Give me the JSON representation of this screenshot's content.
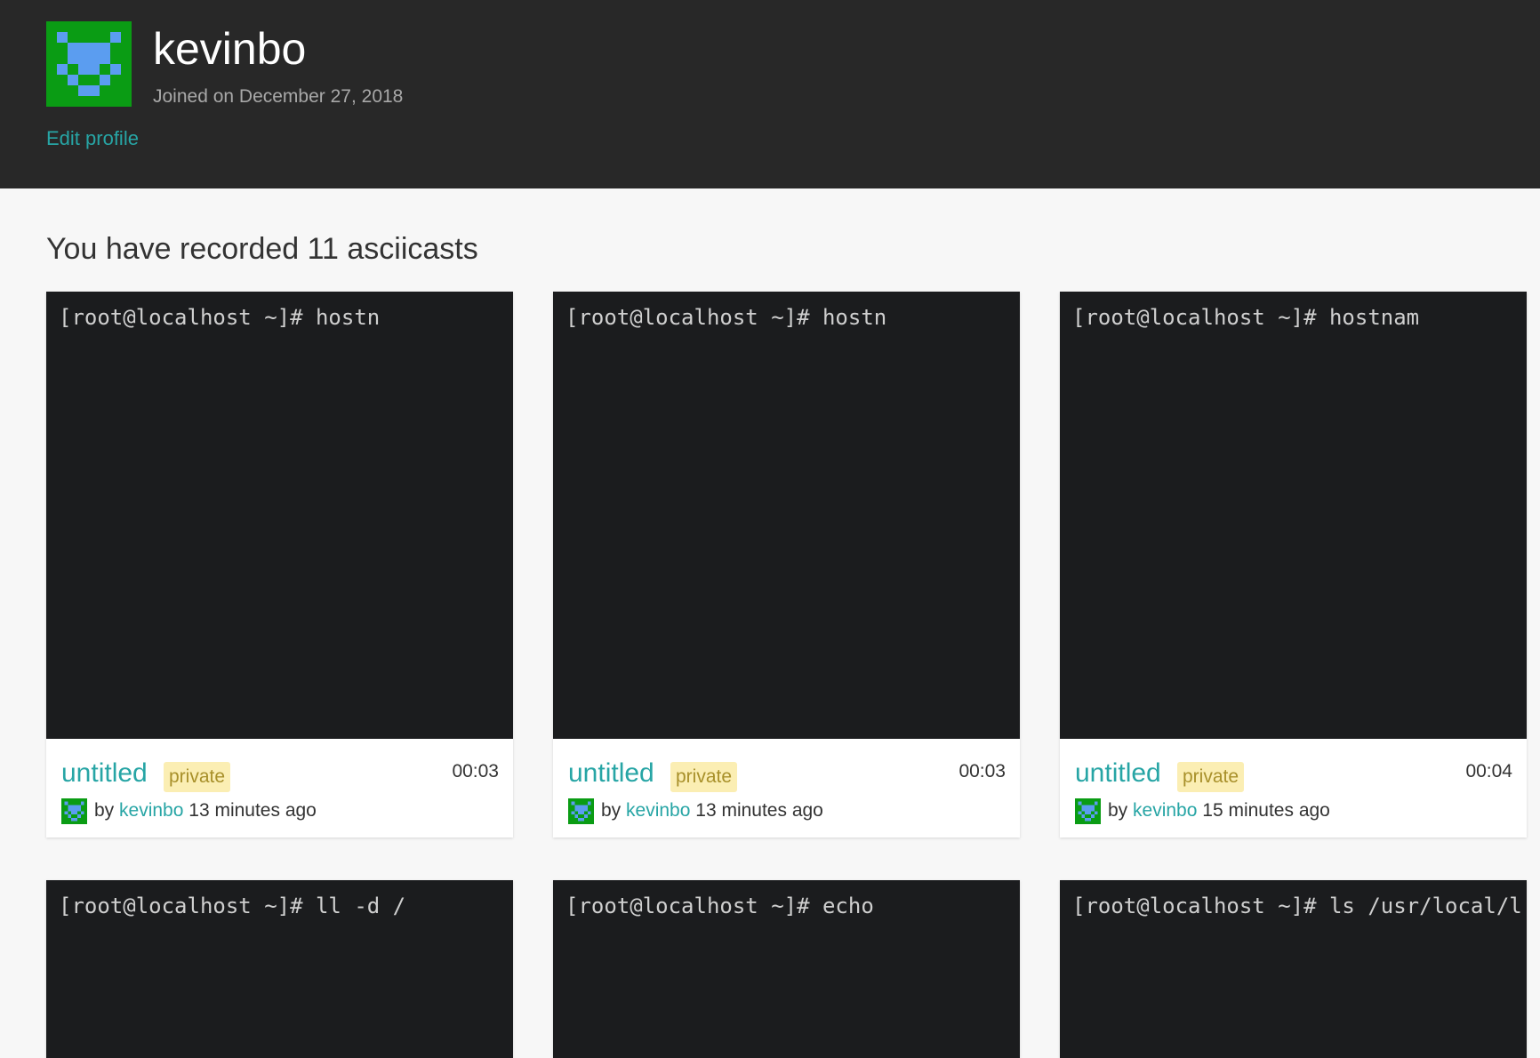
{
  "profile": {
    "username": "kevinbo",
    "joined": "Joined on December 27, 2018",
    "edit_label": "Edit profile"
  },
  "section": {
    "title": "You have recorded 11 asciicasts"
  },
  "cards": [
    {
      "terminal": "[root@localhost ~]# hostn",
      "title": "untitled",
      "badge": "private",
      "duration": "00:03",
      "by": "by",
      "author": "kevinbo",
      "time": "13 minutes ago"
    },
    {
      "terminal": "[root@localhost ~]# hostn",
      "title": "untitled",
      "badge": "private",
      "duration": "00:03",
      "by": "by",
      "author": "kevinbo",
      "time": "13 minutes ago"
    },
    {
      "terminal": "[root@localhost ~]# hostnam",
      "title": "untitled",
      "badge": "private",
      "duration": "00:04",
      "by": "by",
      "author": "kevinbo",
      "time": "15 minutes ago"
    },
    {
      "terminal": "[root@localhost ~]# ll -d /"
    },
    {
      "terminal": "[root@localhost ~]# echo"
    },
    {
      "terminal": "[root@localhost ~]# ls /usr/local/l"
    }
  ],
  "colors": {
    "header_bg": "#282828",
    "accent": "#27a5a5",
    "terminal_bg": "#1b1c1e",
    "badge_bg": "#fbeeb3",
    "avatar_green": "#0a9c14",
    "avatar_blue": "#5b9df0"
  },
  "icons": {
    "avatar": "identicon-avatar"
  }
}
